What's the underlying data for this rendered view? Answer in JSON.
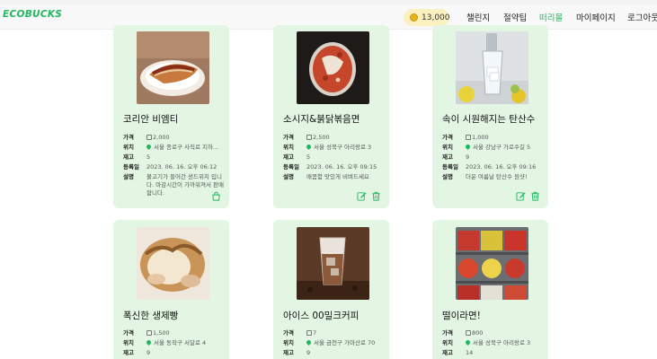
{
  "nav": {
    "logo": "ECOBUCKS",
    "points": "13,000",
    "items": [
      "챌린지",
      "절약팁",
      "떠리몰",
      "마이페이지",
      "로그아웃"
    ],
    "active_index": 2,
    "accent": "#21b85f"
  },
  "field_labels": {
    "price": "가격",
    "location": "위치",
    "stock": "재고",
    "registered": "등록일",
    "description": "설명"
  },
  "products": [
    {
      "title": "코리안 비엠티",
      "price": "2,000",
      "location": "서울 종로구 사직로 지하...",
      "stock": "5",
      "registered": "2023. 06. 16. 오후 06:12",
      "description": "불고기가 들어간 샌드위치 입니다. 마감시간이 가까워져서 판매합니다.",
      "action": "buy"
    },
    {
      "title": "소시지&붉닭볶음면",
      "price": "2,500",
      "location": "서울 성북구 아리랑로 3",
      "stock": "5",
      "registered": "2023. 06. 16. 오후 09:15",
      "description": "매콤함 맛있게 비벼드세요",
      "action": "edit-delete"
    },
    {
      "title": "속이 시원해지는 탄산수",
      "price": "1,000",
      "location": "서울 강남구 가로수길 5",
      "stock": "9",
      "registered": "2023. 06. 16. 오후 09:16",
      "description": "더운 여름날 탄산수 원샷!",
      "action": "edit-delete"
    },
    {
      "title": "폭신한 생제빵",
      "price": "1,500",
      "location": "서울 동작구 서달로 4",
      "stock": "9"
    },
    {
      "title": "아이스 00밀크커피",
      "price": "7",
      "location": "서울 금천구 가마산로 70",
      "stock": "9"
    },
    {
      "title": "떨이라면!",
      "price": "800",
      "location": "서울 성북구 아리랑로 3",
      "stock": "14"
    }
  ]
}
